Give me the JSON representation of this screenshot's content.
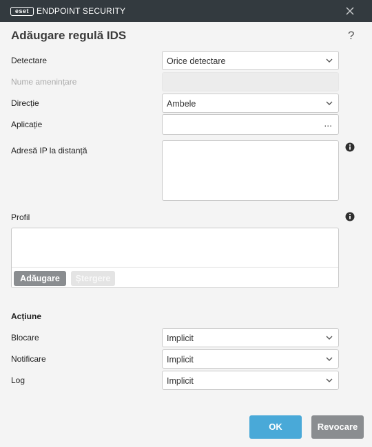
{
  "window": {
    "logo_text": "eset",
    "app_title": "ENDPOINT SECURITY"
  },
  "dialog": {
    "title": "Adăugare regulă IDS",
    "help": "?"
  },
  "form": {
    "detection": {
      "label": "Detectare",
      "value": "Orice detectare"
    },
    "threat_name": {
      "label": "Nume amenințare",
      "value": ""
    },
    "direction": {
      "label": "Direcție",
      "value": "Ambele"
    },
    "application": {
      "label": "Aplicație",
      "value": "",
      "browse": "..."
    },
    "remote_ip": {
      "label": "Adresă IP la distanță",
      "value": ""
    },
    "profile": {
      "label": "Profil",
      "add_label": "Adăugare",
      "delete_label": "Ștergere"
    }
  },
  "action": {
    "heading": "Acțiune",
    "block": {
      "label": "Blocare",
      "value": "Implicit"
    },
    "notify": {
      "label": "Notificare",
      "value": "Implicit"
    },
    "log": {
      "label": "Log",
      "value": "Implicit"
    }
  },
  "footer": {
    "ok_label": "OK",
    "cancel_label": "Revocare"
  },
  "colors": {
    "titlebar": "#333a3f",
    "accent": "#49a9d8",
    "secondary_button": "#8a8d90"
  }
}
